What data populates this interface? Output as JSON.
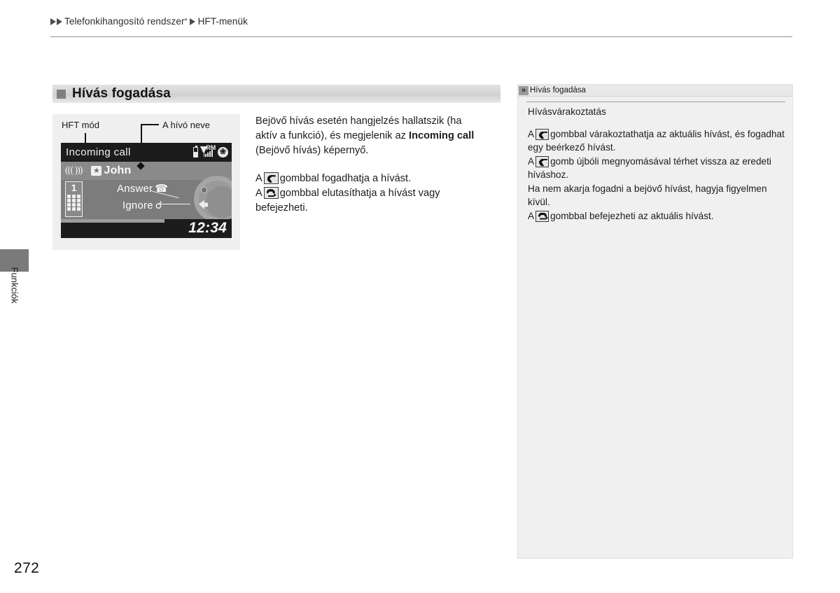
{
  "breadcrumb": {
    "item1": "Telefonkihangosító rendszer",
    "star": "*",
    "item2": "HFT-menük"
  },
  "side_tab": {
    "label": "Funkciók"
  },
  "page_number": "272",
  "section": {
    "title": "Hívás fogadása"
  },
  "figure": {
    "callout_hft": "HFT mód",
    "callout_caller": "A hívó neve",
    "screen": {
      "title": "Incoming call",
      "status_roaming": "RM",
      "status_bluetooth": "B",
      "ring_icon": "((( )))",
      "star_icon": "★",
      "caller_name": "John",
      "keypad_number": "1",
      "option_answer": "Answer",
      "option_ignore": "Ignore",
      "clock": "12:34"
    }
  },
  "body": {
    "para1_a": "Bejövő hívás esetén hangjelzés hallatszik (ha aktív a funkció), és megjelenik az ",
    "para1_bold": "Incoming call",
    "para1_b": " (Bejövő hívás) képernyő.",
    "para2_pre": "A",
    "para2_post": "gombbal fogadhatja a hívást.",
    "para3_pre": "A",
    "para3_post": "gombbal elutasíthatja a hívást vagy befejezheti."
  },
  "sidebar": {
    "header_title": "Hívás fogadása",
    "subtitle": "Hívásvárakoztatás",
    "item1_pre": "A",
    "item1_post": "gombbal várakoztathatja az aktuális hívást, és fogadhat egy beérkező hívást.",
    "item2_pre": "A",
    "item2_post": "gomb újbóli megnyomásával térhet vissza az eredeti híváshoz.",
    "item3": "Ha nem akarja fogadni a bejövő hívást, hagyja figyelmen kívül.",
    "item4_pre": "A",
    "item4_post": "gombbal befejezheti az aktuális hívást."
  }
}
